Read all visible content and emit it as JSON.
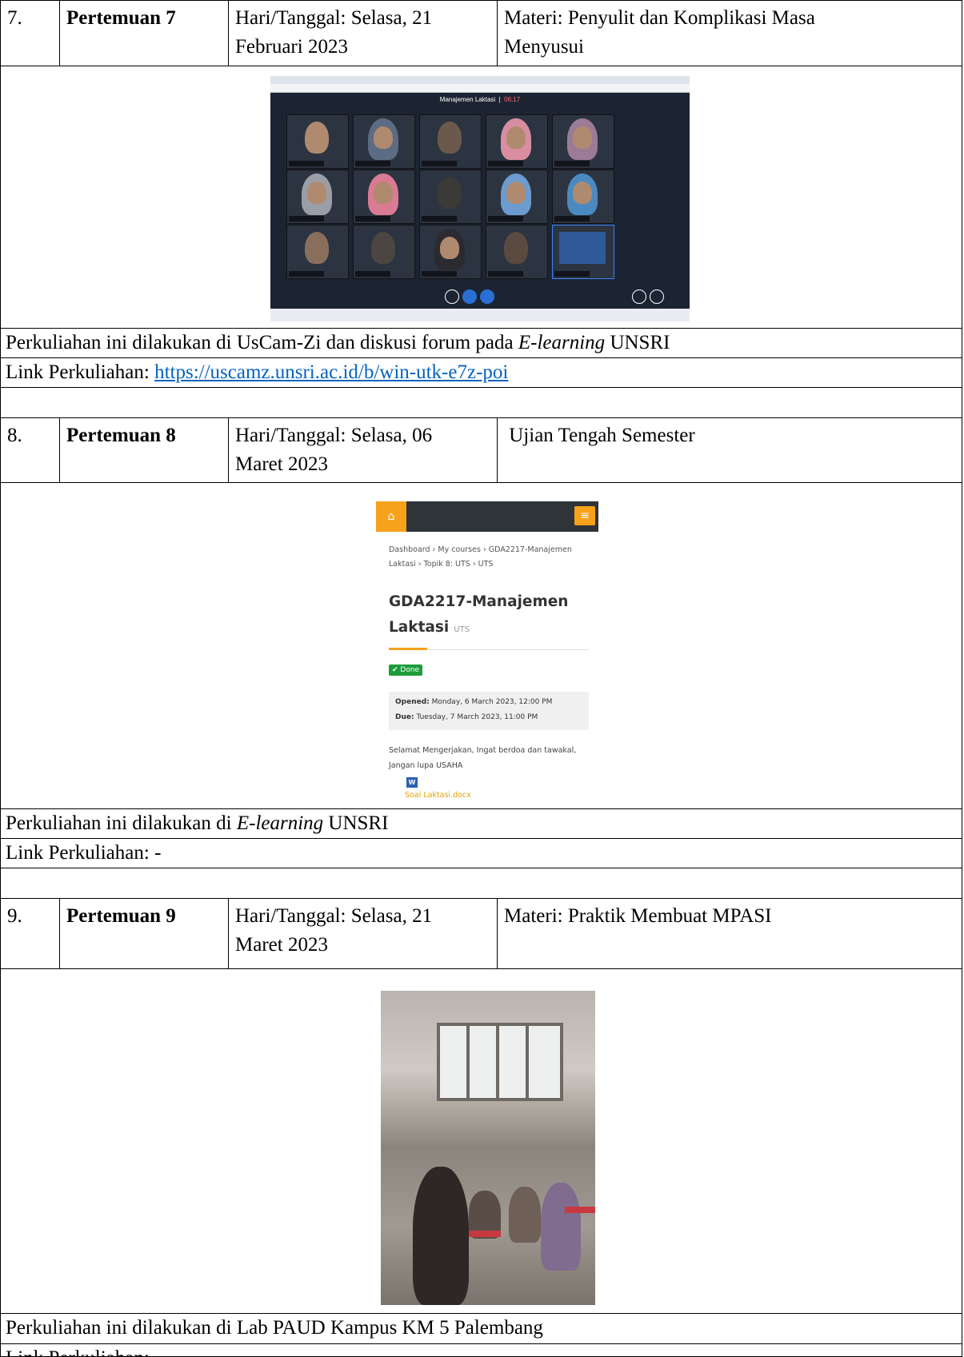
{
  "meetings": [
    {
      "no": "7.",
      "title": "Pertemuan 7",
      "date_line1": "Hari/Tanggal: Selasa, 21",
      "date_line2": "Februari 2023",
      "topic_line1": "Materi: Penyulit dan Komplikasi Masa",
      "topic_line2": "Menyusui",
      "place_prefix": "Perkuliahan ini dilakukan di UsCam-Zi dan diskusi forum pada ",
      "place_em": "E-learning",
      "place_suffix": " UNSRI",
      "link_label": "Link Perkuliahan: ",
      "link_url": "https://uscamz.unsri.ac.id/b/win-utk-e7z-poi"
    },
    {
      "no": "8.",
      "title": "Pertemuan 8",
      "date_line1": "Hari/Tanggal: Selasa, 06",
      "date_line2": "Maret 2023",
      "topic_line1": " Ujian Tengah Semester",
      "topic_line2": "",
      "place_prefix": "Perkuliahan ini dilakukan di ",
      "place_em": "E-learning",
      "place_suffix": " UNSRI",
      "link_label": "Link Perkuliahan: -",
      "link_url": ""
    },
    {
      "no": "9.",
      "title": "Pertemuan 9",
      "date_line1": "Hari/Tanggal: Selasa, 21",
      "date_line2": "Maret 2023",
      "topic_line1": "Materi: Praktik Membuat MPASI",
      "topic_line2": "",
      "place_prefix": "Perkuliahan ini dilakukan di Lab PAUD Kampus KM 5 Palembang",
      "place_em": "",
      "place_suffix": "",
      "link_label": "Link Perkuliahan: -",
      "link_url": ""
    }
  ],
  "vc_screenshot": {
    "room_title": "Manajemen Laktasi",
    "timer": "06:17"
  },
  "moodle": {
    "crumb_line1": "Dashboard › My courses › GDA2217-Manajemen",
    "crumb_line2": "Laktasi › Topik 8: UTS › UTS",
    "title_line1": "GDA2217-Manajemen",
    "title_line2": "Laktasi",
    "title_tag": "UTS",
    "done_label": "✔ Done",
    "opened_label": "Opened:",
    "opened_value": " Monday, 6 March 2023, 12:00 PM",
    "due_label": "Due:",
    "due_value": " Tuesday, 7 March 2023, 11:00 PM",
    "note_line1": "Selamat Mengerjakan, Ingat berdoa dan tawakal,",
    "note_line2": "Jangan lupa USAHA",
    "file_name": "Soal Laktasi.docx",
    "word_icon": "W"
  },
  "colors": {
    "link": "#0563c1",
    "moodle_accent": "#f7a21b",
    "vc_bg": "#1c2433"
  }
}
